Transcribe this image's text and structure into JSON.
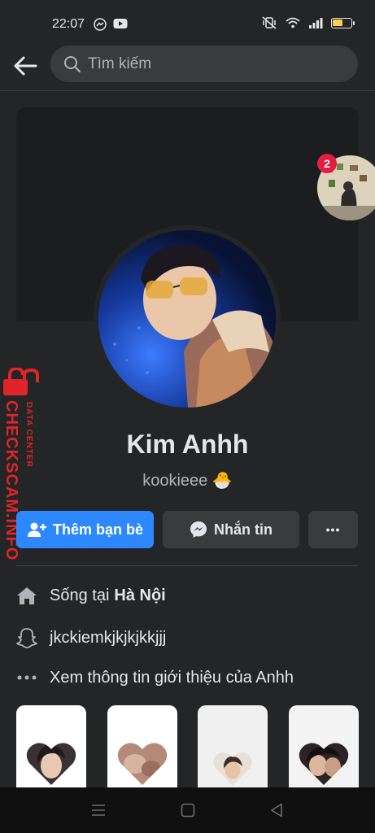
{
  "status": {
    "time": "22:07",
    "battery_level": 0.55,
    "battery_color": "#f7d14c"
  },
  "header": {
    "search_placeholder": "Tìm kiếm",
    "back_icon": "arrow-left-icon",
    "search_icon": "magnifier-icon"
  },
  "chat_head": {
    "badge_count": "2"
  },
  "watermark": {
    "main": "CHECKSCAM.INFO",
    "sub": "DATA CENTER"
  },
  "profile": {
    "name": "Kim Anhh",
    "nickname": "kookieee 🐣"
  },
  "actions": {
    "add_friend": "Thêm bạn bè",
    "message": "Nhắn tin",
    "more": "•••"
  },
  "intro": {
    "lives_in_prefix": "Sống tại",
    "lives_in_place": "Hà Nội",
    "snapchat": "jkckiemkjkjkjkkjjj",
    "see_about": "Xem thông tin giới thiệu của Anhh"
  },
  "colors": {
    "accent": "#2d88ff",
    "background": "#242526",
    "watermark": "#e0252a",
    "badge": "#e41e3f"
  }
}
